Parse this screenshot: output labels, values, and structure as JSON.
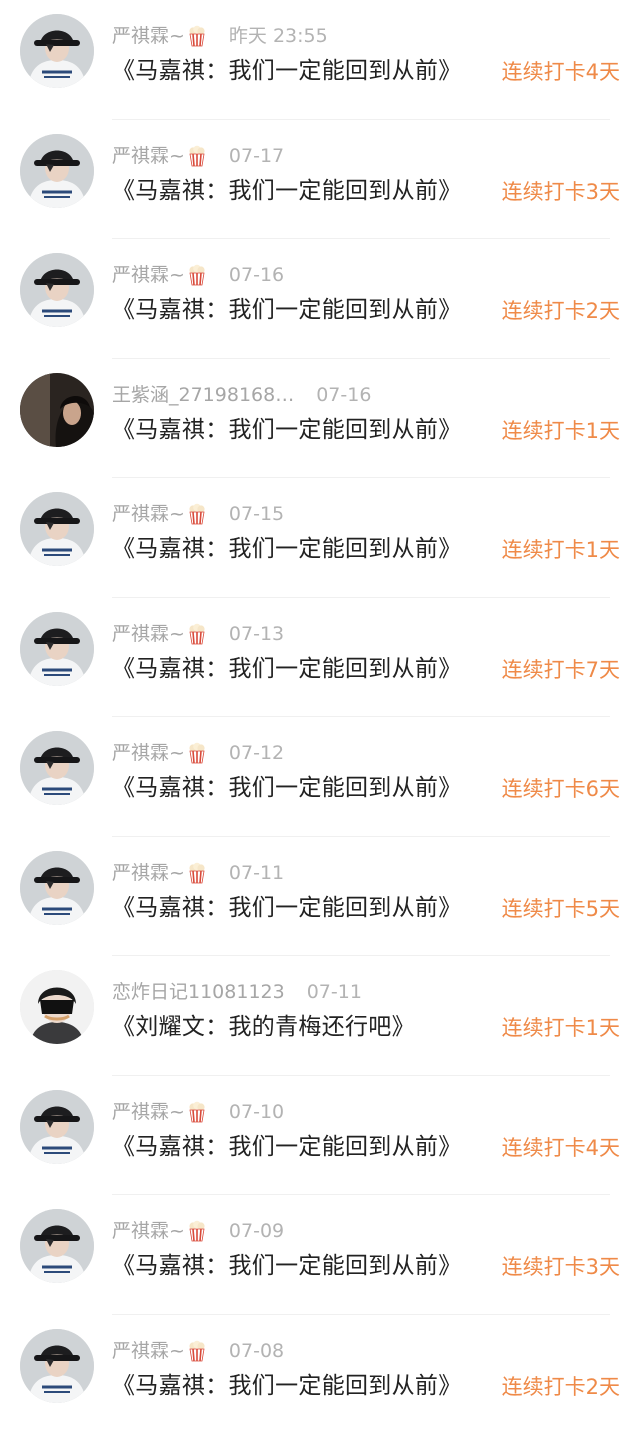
{
  "colors": {
    "streak": "#ef8a48",
    "meta": "#a6a6a6",
    "title": "#222222"
  },
  "entries": [
    {
      "avatar": "boy-black-hat-avatar",
      "username": "严祺霖~",
      "badge": "popcorn-icon",
      "time": "昨天 23:55",
      "title": "《马嘉祺：我们一定能回到从前》",
      "streak": "连续打卡4天"
    },
    {
      "avatar": "boy-black-hat-avatar",
      "username": "严祺霖~",
      "badge": "popcorn-icon",
      "time": "07-17",
      "title": "《马嘉祺：我们一定能回到从前》",
      "streak": "连续打卡3天"
    },
    {
      "avatar": "boy-black-hat-avatar",
      "username": "严祺霖~",
      "badge": "popcorn-icon",
      "time": "07-16",
      "title": "《马嘉祺：我们一定能回到从前》",
      "streak": "连续打卡2天"
    },
    {
      "avatar": "girl-dark-photo-avatar",
      "username": "王紫涵_27198168…",
      "badge": "",
      "time": "07-16",
      "title": "《马嘉祺：我们一定能回到从前》",
      "streak": "连续打卡1天"
    },
    {
      "avatar": "boy-black-hat-avatar",
      "username": "严祺霖~",
      "badge": "popcorn-icon",
      "time": "07-15",
      "title": "《马嘉祺：我们一定能回到从前》",
      "streak": "连续打卡1天"
    },
    {
      "avatar": "boy-black-hat-avatar",
      "username": "严祺霖~",
      "badge": "popcorn-icon",
      "time": "07-13",
      "title": "《马嘉祺：我们一定能回到从前》",
      "streak": "连续打卡7天"
    },
    {
      "avatar": "boy-black-hat-avatar",
      "username": "严祺霖~",
      "badge": "popcorn-icon",
      "time": "07-12",
      "title": "《马嘉祺：我们一定能回到从前》",
      "streak": "连续打卡6天"
    },
    {
      "avatar": "boy-black-hat-avatar",
      "username": "严祺霖~",
      "badge": "popcorn-icon",
      "time": "07-11",
      "title": "《马嘉祺：我们一定能回到从前》",
      "streak": "连续打卡5天"
    },
    {
      "avatar": "masked-boy-avatar",
      "username": "恋炸日记11081123",
      "badge": "",
      "time": "07-11",
      "title": "《刘耀文：我的青梅还行吧》",
      "streak": "连续打卡1天"
    },
    {
      "avatar": "boy-black-hat-avatar",
      "username": "严祺霖~",
      "badge": "popcorn-icon",
      "time": "07-10",
      "title": "《马嘉祺：我们一定能回到从前》",
      "streak": "连续打卡4天"
    },
    {
      "avatar": "boy-black-hat-avatar",
      "username": "严祺霖~",
      "badge": "popcorn-icon",
      "time": "07-09",
      "title": "《马嘉祺：我们一定能回到从前》",
      "streak": "连续打卡3天"
    },
    {
      "avatar": "boy-black-hat-avatar",
      "username": "严祺霖~",
      "badge": "popcorn-icon",
      "time": "07-08",
      "title": "《马嘉祺：我们一定能回到从前》",
      "streak": "连续打卡2天"
    }
  ]
}
